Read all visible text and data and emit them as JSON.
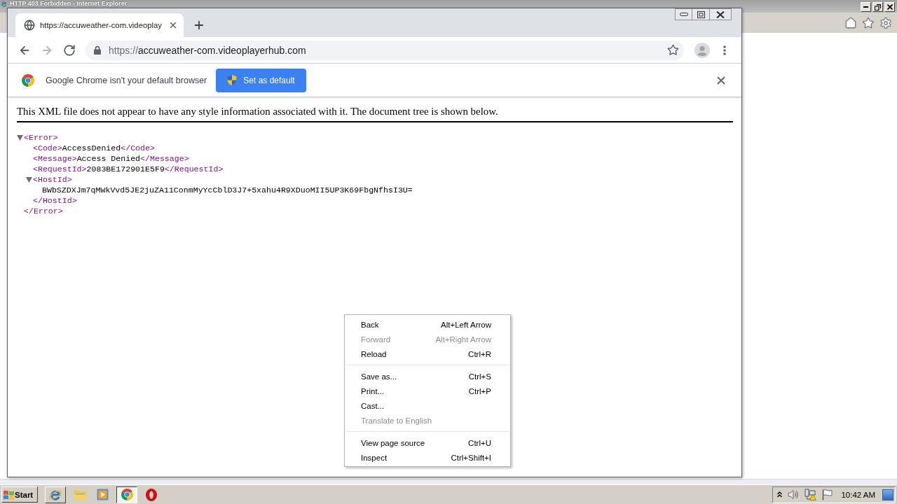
{
  "ie_window": {
    "title": "HTTP 403 Forbidden - Internet Explorer"
  },
  "chrome": {
    "tabs": [
      {
        "title": "https://accuweather-com.videoplay",
        "selected": true
      }
    ],
    "nav_buttons": [
      {
        "kind": "back",
        "disabled": false
      },
      {
        "kind": "forward",
        "disabled": true
      },
      {
        "kind": "reload",
        "disabled": false
      }
    ],
    "address": {
      "scheme": "https://",
      "host": "accuweather-com.videoplayerhub.com"
    },
    "infobar": {
      "message": "Google Chrome isn't your default browser",
      "button": "Set as default"
    }
  },
  "page": {
    "notice": "This XML file does not appear to have any style information associated with it. The document tree is shown below.",
    "document_tree": {
      "kind": "element",
      "open": "<Error>",
      "expanded": true,
      "children": [
        {
          "kind": "leaf",
          "open": "<Code>",
          "text": "AccessDenied",
          "close": "</Code>"
        },
        {
          "kind": "leaf",
          "open": "<Message>",
          "text": "Access Denied",
          "close": "</Message>"
        },
        {
          "kind": "leaf",
          "open": "<RequestId>",
          "text": "2083BE172901E5F9",
          "close": "</RequestId>"
        },
        {
          "kind": "element",
          "open": "<HostId>",
          "expanded": true,
          "children": [
            {
              "kind": "text",
              "text": "BWbSZDXJm7qMWkVvd5JE2juZA11ConmMyYcCblD3J7+5xahu4R9XDuoMII5UP3K69FbgNfhsI3U="
            }
          ],
          "close": "</HostId>"
        }
      ],
      "close": "</Error>"
    }
  },
  "context_menu": {
    "groups": [
      {
        "items": [
          {
            "label": "Back",
            "shortcut": "Alt+Left Arrow",
            "disabled": false
          },
          {
            "label": "Forward",
            "shortcut": "Alt+Right Arrow",
            "disabled": true
          },
          {
            "label": "Reload",
            "shortcut": "Ctrl+R",
            "disabled": false
          }
        ]
      },
      {
        "items": [
          {
            "label": "Save as...",
            "shortcut": "Ctrl+S",
            "disabled": false
          },
          {
            "label": "Print...",
            "shortcut": "Ctrl+P",
            "disabled": false
          },
          {
            "label": "Cast...",
            "disabled": false
          },
          {
            "label": "Translate to English",
            "disabled": true
          }
        ]
      },
      {
        "items": [
          {
            "label": "View page source",
            "shortcut": "Ctrl+U",
            "disabled": false
          },
          {
            "label": "Inspect",
            "shortcut": "Ctrl+Shift+I",
            "disabled": false
          }
        ]
      }
    ]
  },
  "taskbar": {
    "start": "Start",
    "items": [
      {
        "kind": "task",
        "selected": false
      },
      {
        "kind": "launcher",
        "selected": false
      },
      {
        "kind": "launcher",
        "selected": false
      },
      {
        "kind": "task",
        "selected": true
      },
      {
        "kind": "launcher",
        "selected": false
      }
    ],
    "clock": "10:42 AM"
  }
}
